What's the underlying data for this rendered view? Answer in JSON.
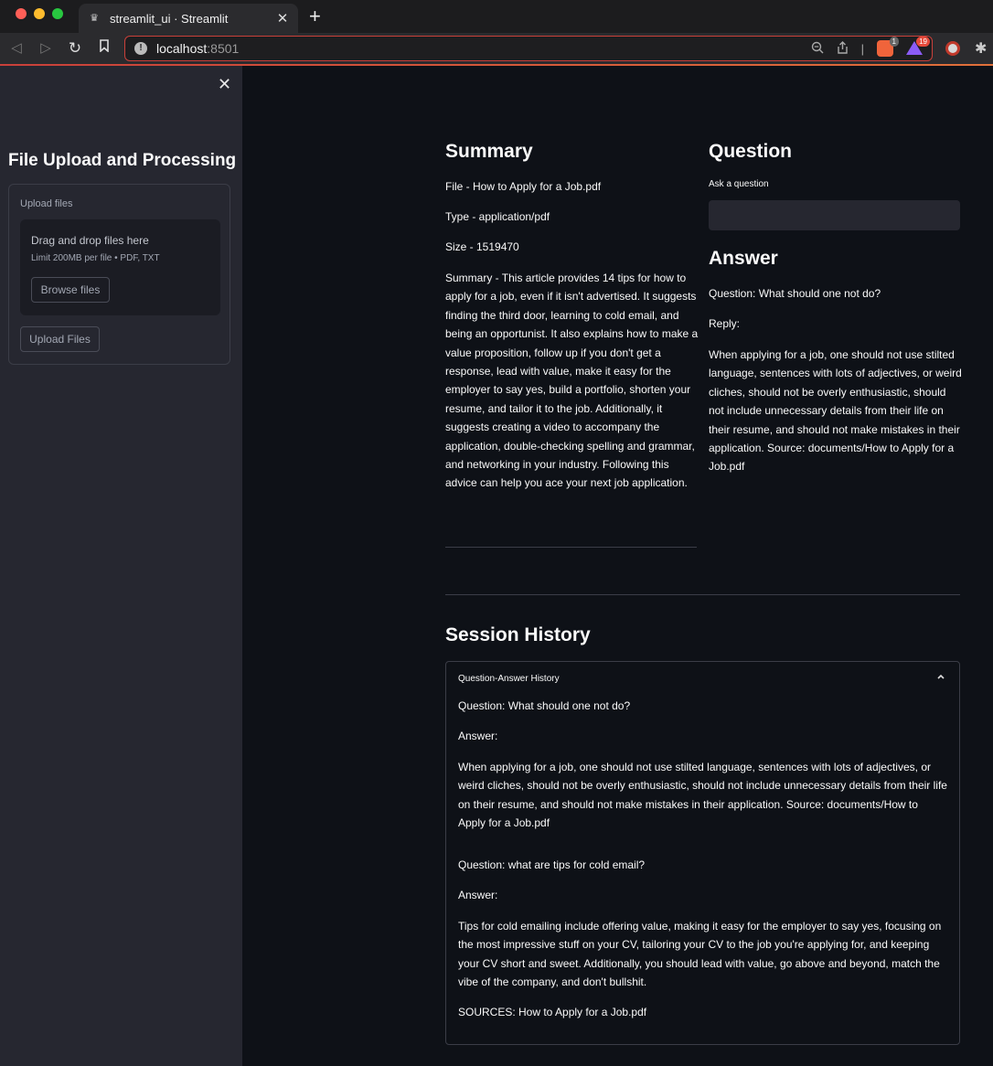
{
  "browser": {
    "tab_title": "streamlit_ui · Streamlit",
    "url_host": "localhost",
    "url_port": ":8501",
    "brave_badge": "1",
    "rewards_badge": "19"
  },
  "sidebar": {
    "title": "File Upload and Processing",
    "upload_label": "Upload files",
    "dropzone_text": "Drag and drop files here",
    "dropzone_limit": "Limit 200MB per file • PDF, TXT",
    "browse_button": "Browse files",
    "upload_button": "Upload Files"
  },
  "summary": {
    "heading": "Summary",
    "file": "File - How to Apply for a Job.pdf",
    "type": "Type - application/pdf",
    "size": "Size - 1519470",
    "text": "Summary - This article provides 14 tips for how to apply for a job, even if it isn't advertised. It suggests finding the third door, learning to cold email, and being an opportunist. It also explains how to make a value proposition, follow up if you don't get a response, lead with value, make it easy for the employer to say yes, build a portfolio, shorten your resume, and tailor it to the job. Additionally, it suggests creating a video to accompany the application, double-checking spelling and grammar, and networking in your industry. Following this advice can help you ace your next job application."
  },
  "question": {
    "heading": "Question",
    "label": "Ask a question",
    "value": ""
  },
  "answer": {
    "heading": "Answer",
    "question": "Question: What should one not do?",
    "reply_label": "Reply:",
    "reply": "When applying for a job, one should not use stilted language, sentences with lots of adjectives, or weird cliches, should not be overly enthusiastic, should not include unnecessary details from their life on their resume, and should not make mistakes in their application. Source: documents/How to Apply for a Job.pdf"
  },
  "history": {
    "heading": "Session History",
    "expander_label": "Question-Answer History",
    "q1": "Question: What should one not do?",
    "a1_label": "Answer:",
    "a1": "When applying for a job, one should not use stilted language, sentences with lots of adjectives, or weird cliches, should not be overly enthusiastic, should not include unnecessary details from their life on their resume, and should not make mistakes in their application. Source: documents/How to Apply for a Job.pdf",
    "q2": "Question: what are tips for cold email?",
    "a2_label": "Answer:",
    "a2": "Tips for cold emailing include offering value, making it easy for the employer to say yes, focusing on the most impressive stuff on your CV, tailoring your CV to the job you're applying for, and keeping your CV short and sweet. Additionally, you should lead with value, go above and beyond, match the vibe of the company, and don't bullshit.",
    "sources": "SOURCES: How to Apply for a Job.pdf"
  },
  "icons": {
    "close": "close-icon",
    "chevron": "chevron-up-icon"
  }
}
